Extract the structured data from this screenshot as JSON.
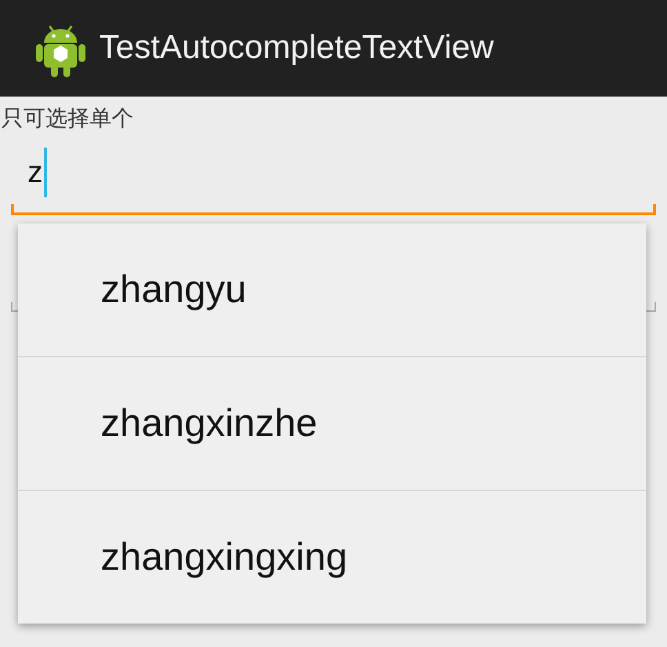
{
  "action_bar": {
    "title": "TestAutocompleteTextView"
  },
  "fields": [
    {
      "label": "只可选择单个",
      "value": "z",
      "focused": true
    },
    {
      "focused": false
    }
  ],
  "suggestions": [
    {
      "text": "zhangyu"
    },
    {
      "text": "zhangxinzhe"
    },
    {
      "text": "zhangxingxing"
    }
  ]
}
